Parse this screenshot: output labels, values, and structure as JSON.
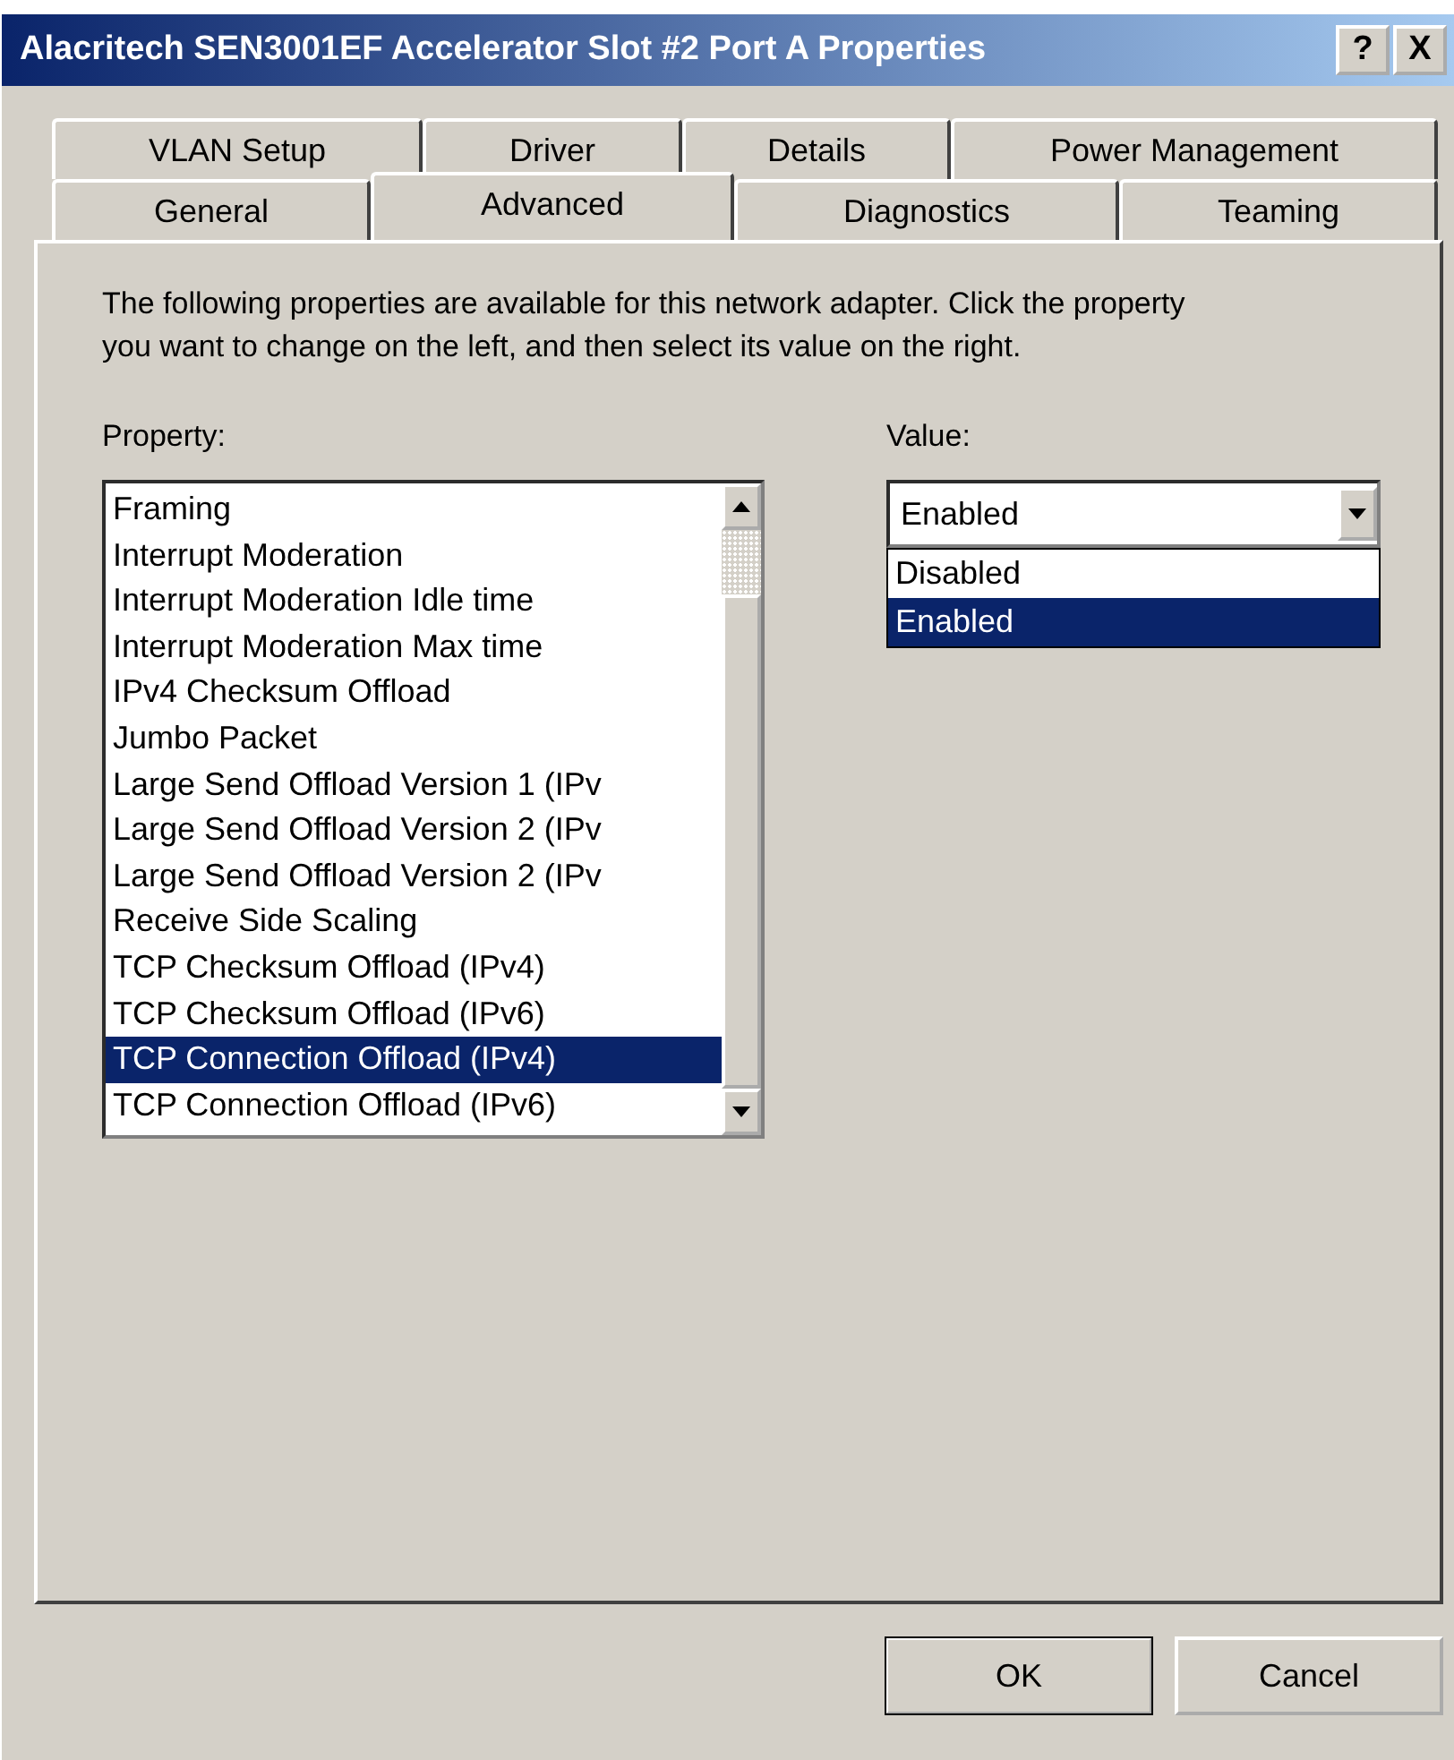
{
  "window": {
    "title": "Alacritech SEN3001EF Accelerator Slot #2 Port A Properties",
    "help_button": "?",
    "close_button": "X"
  },
  "tab_rows": [
    [
      {
        "label": "VLAN Setup",
        "selected": false
      },
      {
        "label": "Driver",
        "selected": false
      },
      {
        "label": "Details",
        "selected": false
      },
      {
        "label": "Power Management",
        "selected": false
      }
    ],
    [
      {
        "label": "General",
        "selected": false
      },
      {
        "label": "Advanced",
        "selected": true
      },
      {
        "label": "Diagnostics",
        "selected": false
      },
      {
        "label": "Teaming",
        "selected": false
      }
    ]
  ],
  "description": "The following properties are available for this network adapter. Click the property you want to change on the left, and then select its value on the right.",
  "property": {
    "label": "Property:",
    "items": [
      {
        "label": "Framing",
        "selected": false
      },
      {
        "label": "Interrupt Moderation",
        "selected": false
      },
      {
        "label": "Interrupt Moderation Idle time",
        "selected": false
      },
      {
        "label": "Interrupt Moderation Max time",
        "selected": false
      },
      {
        "label": "IPv4 Checksum Offload",
        "selected": false
      },
      {
        "label": "Jumbo Packet",
        "selected": false
      },
      {
        "label": "Large Send Offload Version 1 (IPv",
        "selected": false
      },
      {
        "label": "Large Send Offload Version 2 (IPv",
        "selected": false
      },
      {
        "label": "Large Send Offload Version 2 (IPv",
        "selected": false
      },
      {
        "label": "Receive Side Scaling",
        "selected": false
      },
      {
        "label": "TCP Checksum Offload (IPv4)",
        "selected": false
      },
      {
        "label": "TCP Checksum Offload (IPv6)",
        "selected": false
      },
      {
        "label": "TCP Connection Offload (IPv4)",
        "selected": true
      },
      {
        "label": "TCP Connection Offload (IPv6)",
        "selected": false
      }
    ]
  },
  "value": {
    "label": "Value:",
    "current": "Enabled",
    "options": [
      {
        "label": "Disabled",
        "selected": false
      },
      {
        "label": "Enabled",
        "selected": true
      }
    ]
  },
  "buttons": [
    {
      "label": "OK",
      "default": true
    },
    {
      "label": "Cancel",
      "default": false
    }
  ]
}
